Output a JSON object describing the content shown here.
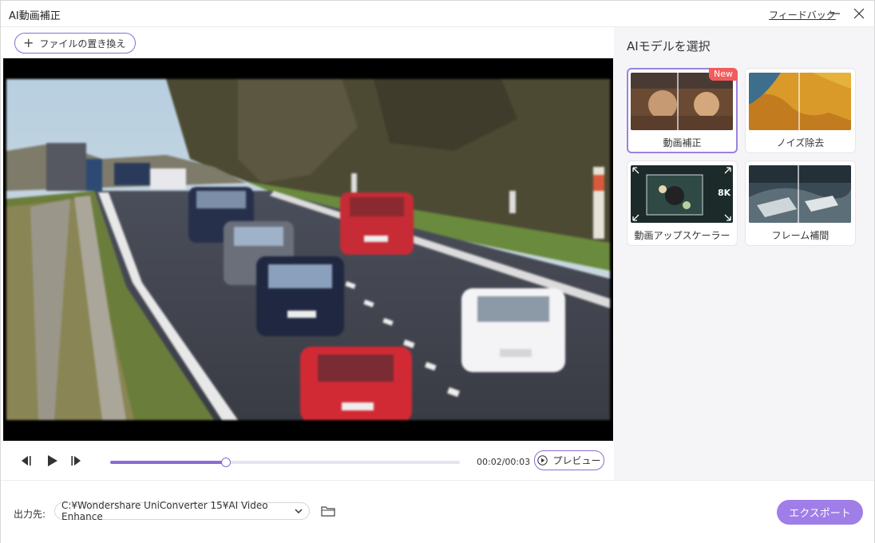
{
  "window": {
    "title": "AI動画補正",
    "feedback_label": "フィードバック"
  },
  "toolbar": {
    "replace_file_label": "ファイルの置き換え"
  },
  "player": {
    "time_display": "00:02/00:03",
    "progress": 0.33,
    "preview_label": "プレビュー"
  },
  "side": {
    "title": "AIモデルを選択",
    "models": [
      {
        "label": "動画補正",
        "selected": true,
        "badge": "New"
      },
      {
        "label": "ノイズ除去",
        "selected": false
      },
      {
        "label": "動画アップスケーラー",
        "selected": false,
        "badge_text": "8K"
      },
      {
        "label": "フレーム補間",
        "selected": false
      }
    ]
  },
  "output": {
    "label": "出力先:",
    "path": "C:¥Wondershare UniConverter 15¥AI Video Enhance",
    "export_label": "エクスポート"
  },
  "colors": {
    "accent": "#8b6cd6",
    "export_bg": "#a07ee8",
    "badge_new": "#f25c5c",
    "side_bg": "#f5f5f7"
  },
  "icons": [
    "minimize-icon",
    "close-icon",
    "plus-icon",
    "skip-back-icon",
    "play-icon",
    "skip-forward-icon",
    "preview-play-icon",
    "chevron-down-icon",
    "folder-icon"
  ]
}
